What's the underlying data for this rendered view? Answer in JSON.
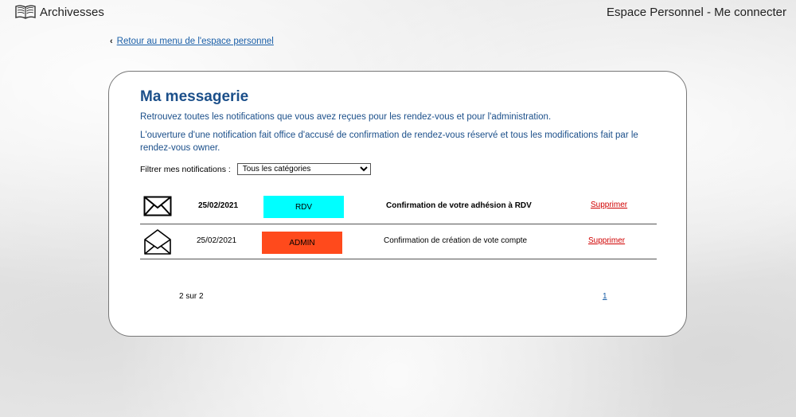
{
  "header": {
    "brand": "Archivesses",
    "brand_icon": "book-icon",
    "user_link": "Espace Personnel - Me connecter"
  },
  "back_link": "Retour au menu de l'espace personnel",
  "messagerie": {
    "title": "Ma messagerie",
    "intro1": "Retrouvez toutes les notifications que vous avez reçues pour les rendez-vous et pour l'administration.",
    "intro2": "L'ouverture d'une notification fait office d'accusé de confirmation de rendez-vous réservé et tous les modifications fait par le rendez-vous owner.",
    "filter_label": "Filtrer mes notifications :",
    "filter_value": "Tous les catégories"
  },
  "notifications": [
    {
      "icon": "envelope-closed-icon",
      "date": "25/02/2021",
      "category": "RDV",
      "category_color": "#00ffff",
      "subject": "Confirmation de votre adhésion à RDV",
      "delete": "Supprimer",
      "unread": true
    },
    {
      "icon": "envelope-open-icon",
      "date": "25/02/2021",
      "category": "ADMIN",
      "category_color": "#ff4a1c",
      "subject": "Confirmation de création de vote compte",
      "delete": "Supprimer",
      "unread": false
    }
  ],
  "pagination": {
    "count": "2 sur 2",
    "page": "1"
  }
}
